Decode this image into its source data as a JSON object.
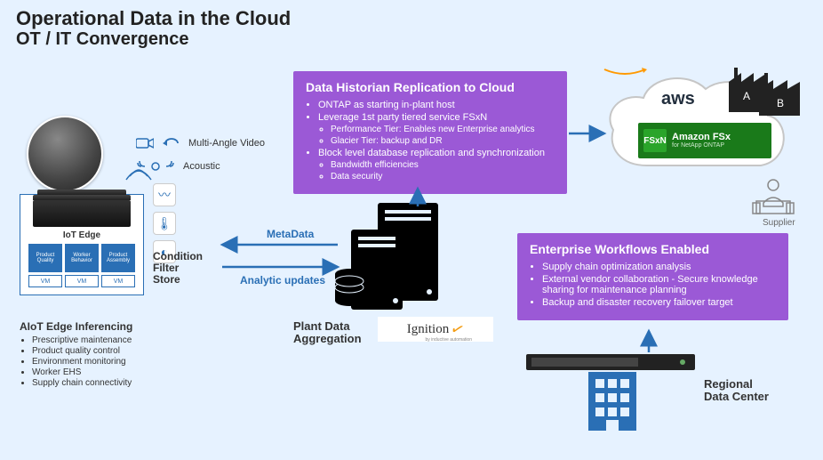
{
  "title_line1": "Operational Data in the  Cloud",
  "title_line2": "OT / IT Convergence",
  "box1": {
    "title": "Data Historian Replication to Cloud",
    "b1": "ONTAP as starting in-plant host",
    "b2": "Leverage 1st party tiered service FSxN",
    "b2a": "Performance Tier: Enables new Enterprise analytics",
    "b2b": "Glacier Tier: backup and DR",
    "b3": "Block level database replication and synchronization",
    "b3a": "Bandwidth efficiencies",
    "b3b": "Data security"
  },
  "box2": {
    "title": "Enterprise Workflows Enabled",
    "b1": "Supply chain optimization analysis",
    "b2": "External vendor collaboration - Secure knowledge sharing for maintenance planning",
    "b3": "Backup and disaster recovery failover target"
  },
  "cloud": {
    "aws": "aws",
    "fsx_title": "Amazon FSx",
    "fsx_sub": "for NetApp ONTAP",
    "fsx_badge": "FSxN"
  },
  "factory_a": "A",
  "factory_b": "B",
  "supplier": "Supplier",
  "iot": {
    "label": "IoT Edge",
    "t1": "Product Quality",
    "t2": "Worker Behavior",
    "t3": "Product Assembly",
    "vm": "VM"
  },
  "aiot": {
    "title": "AIoT Edge Inferencing",
    "i1": "Prescriptive maintenance",
    "i2": "Product quality control",
    "i3": "Environment monitoring",
    "i4": "Worker EHS",
    "i5": "Supply chain connectivity"
  },
  "sensors": {
    "video": "Multi-Angle Video",
    "acoustic": "Acoustic"
  },
  "cfs": "Condition\nFilter\nStore",
  "arrows": {
    "metadata": "MetaData",
    "analytic": "Analytic updates"
  },
  "plant": "Plant Data\nAggregation",
  "ignition": "Ignition",
  "rdc": "Regional\nData Center"
}
